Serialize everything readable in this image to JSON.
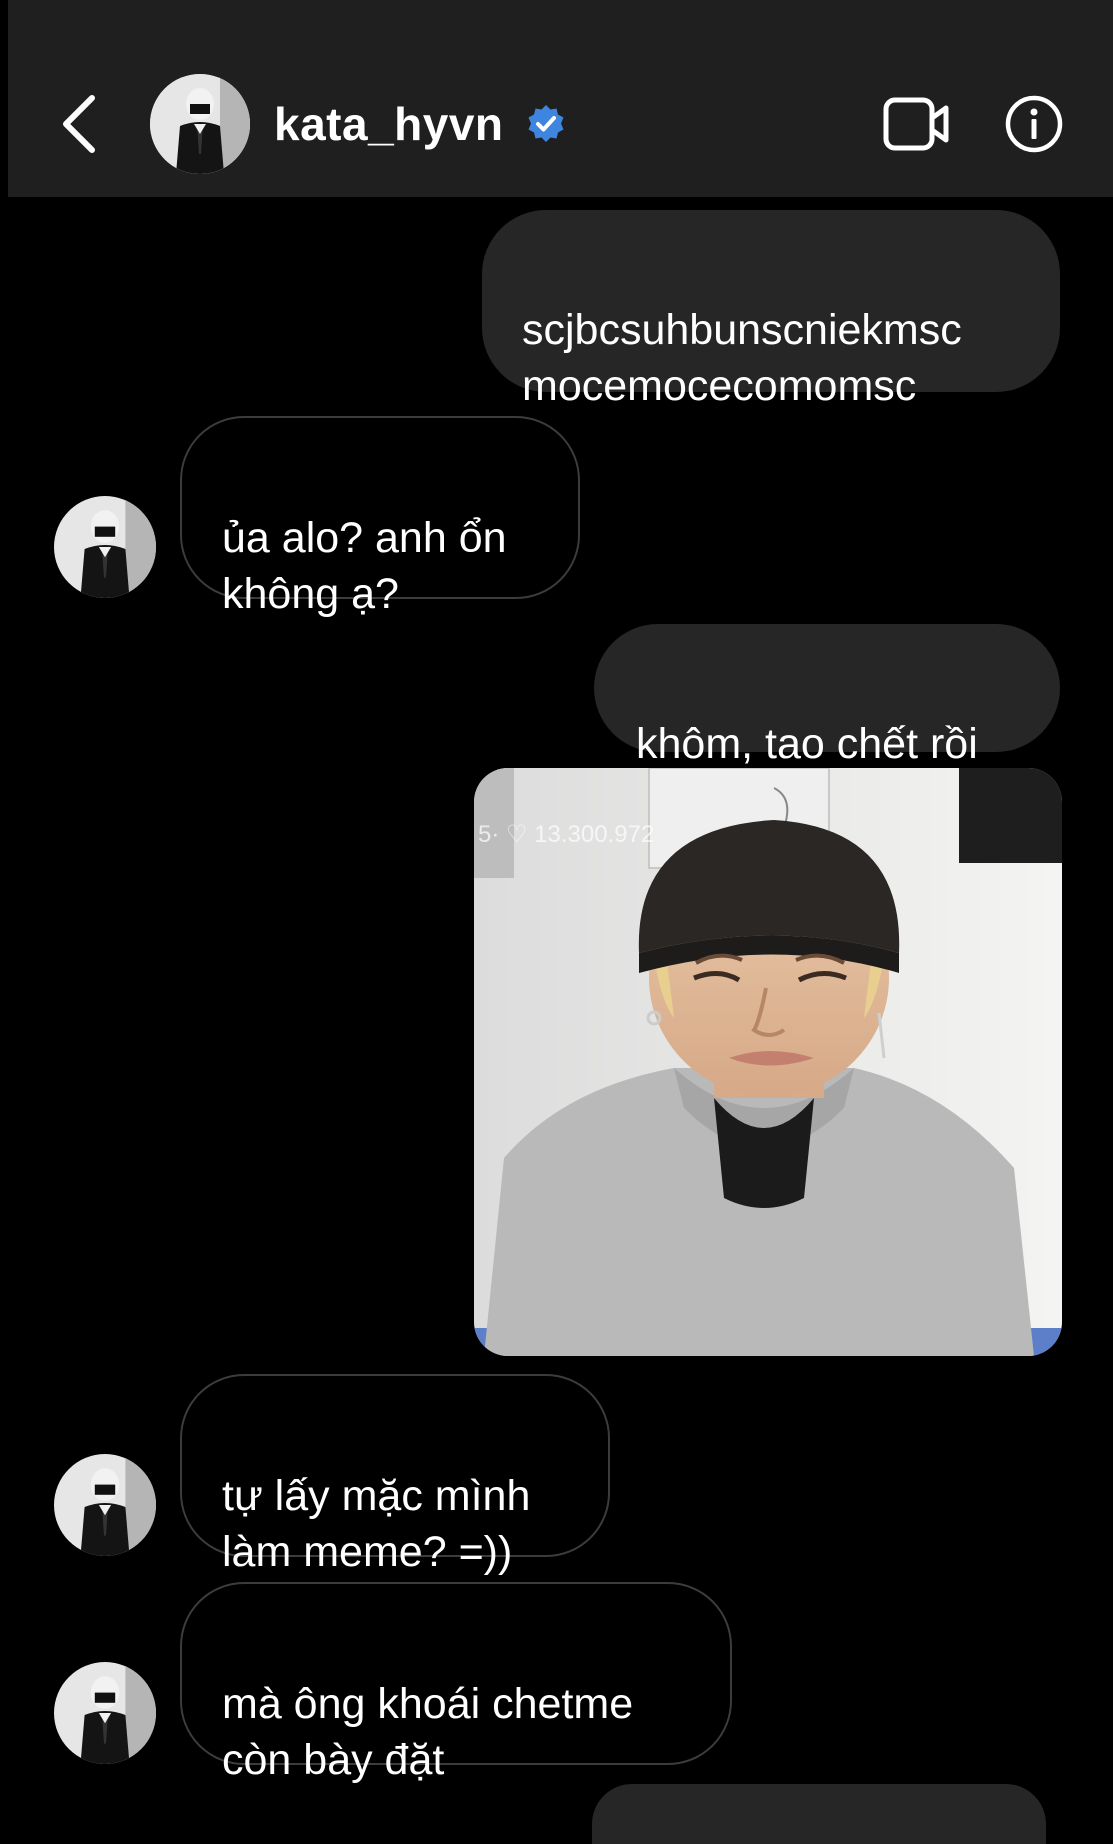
{
  "header": {
    "back_icon": "chevron-left-icon",
    "username": "kata_hyvn",
    "verified_icon": "verified-badge-icon",
    "video_icon": "video-camera-icon",
    "info_icon": "info-icon",
    "background": "#1f1f1f",
    "verified_color": "#3897f0"
  },
  "messages": [
    {
      "direction": "outgoing",
      "text": "scjbcsuhbunscniekmsc\nmocemocecomomsc"
    },
    {
      "direction": "incoming",
      "text": "ủa alo? anh ổn\nkhông ạ?"
    },
    {
      "direction": "outgoing",
      "text": "khôm, tao chết rồi"
    },
    {
      "direction": "outgoing",
      "type": "photo",
      "overlay_text": "5·  ♡ 13.300.972"
    },
    {
      "direction": "incoming",
      "text": "tự lấy mặc mình\nlàm meme? =))"
    },
    {
      "direction": "incoming",
      "text": "mà ông khoái chetme\ncòn bày đặt"
    }
  ],
  "colors": {
    "outgoing_bubble": "#262626",
    "incoming_border": "#3c3c3c",
    "background": "#000000"
  }
}
